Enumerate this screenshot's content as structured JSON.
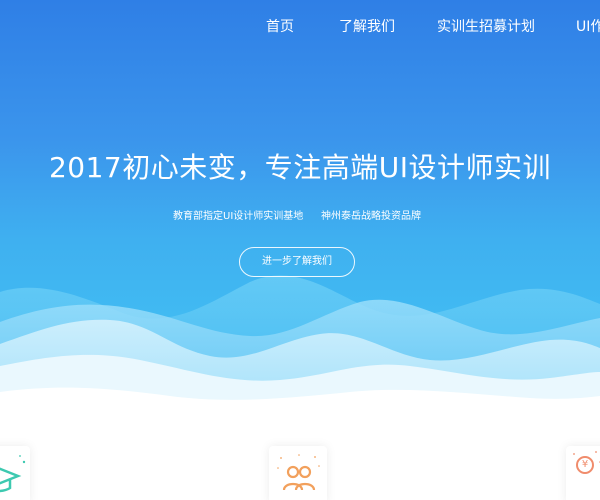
{
  "nav": {
    "items": [
      {
        "label": "首页"
      },
      {
        "label": "了解我们"
      },
      {
        "label": "实训生招募计划"
      },
      {
        "label": "UI作"
      }
    ]
  },
  "hero": {
    "headline": "2017初心未变，专注高端UI设计师实训",
    "sub_left": "教育部指定UI设计师实训基地",
    "sub_right": "神州泰岳战略投资品牌",
    "cta_label": "进一步了解我们"
  },
  "features": {
    "yen_symbol": "¥",
    "icons": [
      "graduation-cap-icon",
      "users-icon",
      "yen-icon"
    ]
  },
  "colors": {
    "hero_top": "#2f7fe6",
    "hero_bottom": "#43c5f4",
    "accent_teal": "#3dc9b0",
    "accent_orange": "#f2a05c",
    "accent_coral": "#f08c6c"
  }
}
